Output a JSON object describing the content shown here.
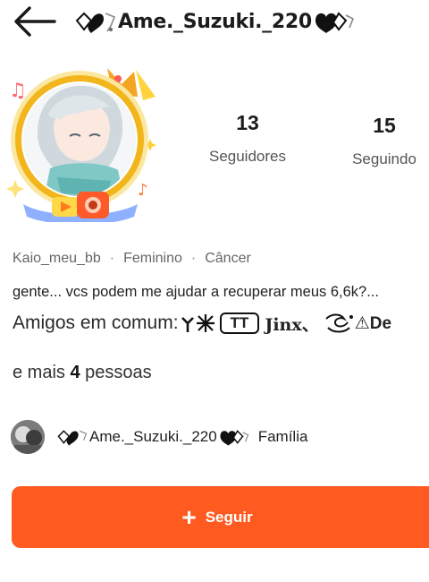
{
  "header": {
    "back_icon": "arrow-left-icon",
    "title": "Ame._Suzuki._220"
  },
  "profile": {
    "followers_count": "13",
    "followers_label": "Seguidores",
    "following_count": "15",
    "following_label": "Seguindo",
    "meta": [
      "Kaio_meu_bb",
      "Feminino",
      "Câncer"
    ],
    "meta_separator": "·",
    "bio": "gente... vcs podem me ajudar a recuperar meus 6,6k?..."
  },
  "mutual": {
    "label": "Amigos em comum:",
    "tt_text": "TT",
    "jinx_text": "Jinx、",
    "trailing_text": "⚠De",
    "more_prefix": "e mais",
    "more_count": "4",
    "more_suffix": "pessoas"
  },
  "family": {
    "name": "Ame._Suzuki._220",
    "role": "Família"
  },
  "follow_button": {
    "label": "Seguir",
    "color": "#ff5a1f"
  },
  "colors": {
    "accent": "#ff5a1f",
    "avatar_ring": "#f2b51c"
  }
}
